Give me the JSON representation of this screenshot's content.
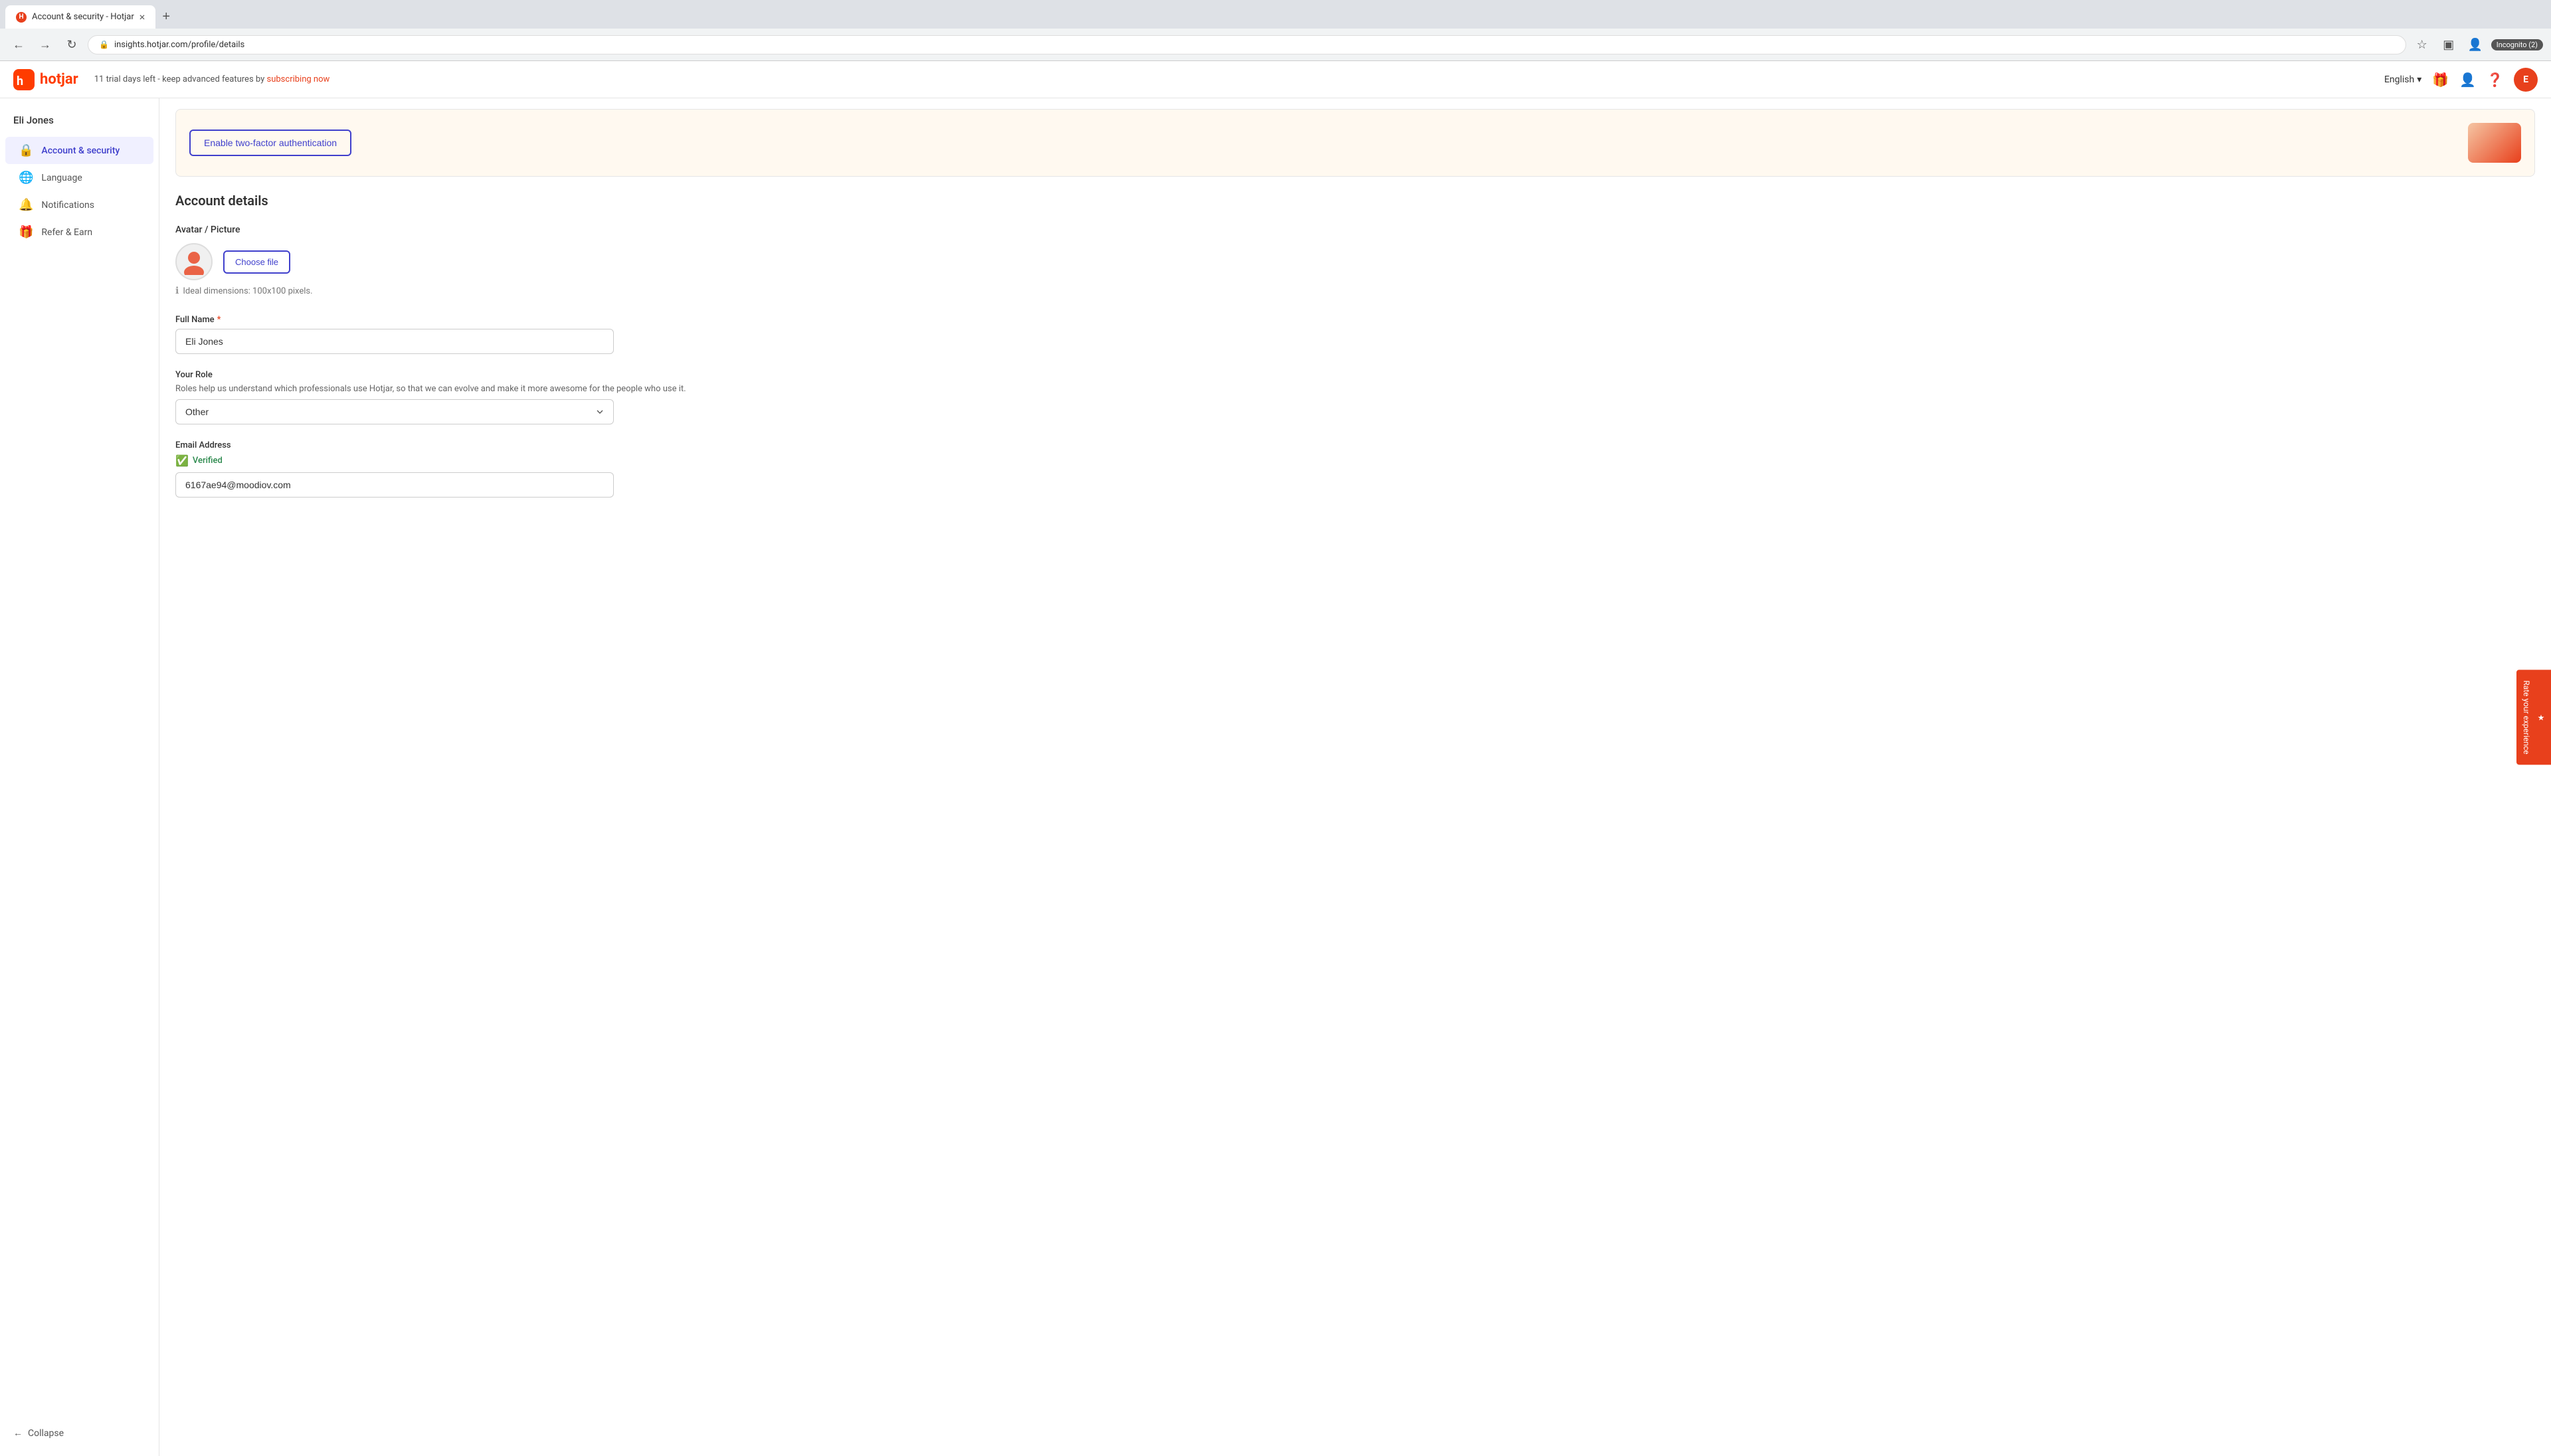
{
  "browser": {
    "tab_title": "Account & security - Hotjar",
    "tab_close": "×",
    "tab_new": "+",
    "address": "insights.hotjar.com/profile/details",
    "back_btn": "←",
    "forward_btn": "→",
    "refresh_btn": "↻",
    "star_btn": "★",
    "incognito_label": "Incognito (2)"
  },
  "header": {
    "logo_text": "hotjar",
    "trial_text": "11 trial days left - keep advanced features by",
    "trial_link_text": "subscribing now",
    "lang_label": "English",
    "lang_arrow": "▾"
  },
  "sidebar": {
    "user_name": "Eli Jones",
    "items": [
      {
        "id": "account-security",
        "label": "Account & security",
        "icon": "🔒",
        "active": true
      },
      {
        "id": "language",
        "label": "Language",
        "icon": "🌐",
        "active": false
      },
      {
        "id": "notifications",
        "label": "Notifications",
        "icon": "🔔",
        "active": false
      },
      {
        "id": "refer-earn",
        "label": "Refer & Earn",
        "icon": "🎁",
        "active": false
      }
    ],
    "collapse_label": "Collapse",
    "collapse_icon": "←"
  },
  "top_card": {
    "btn_label": "Enable two-factor authentication"
  },
  "main": {
    "section_title": "Account details",
    "avatar_label": "Avatar / Picture",
    "choose_file_label": "Choose file",
    "avatar_hint": "Ideal dimensions: 100x100 pixels.",
    "full_name_label": "Full Name",
    "full_name_required": "*",
    "full_name_value": "Eli Jones",
    "role_label": "Your Role",
    "role_description": "Roles help us understand which professionals use Hotjar, so that we can evolve and make it more awesome for the people who use it.",
    "role_value": "Other",
    "email_label": "Email Address",
    "verified_label": "Verified",
    "email_value": "6167ae94@moodiov.com"
  },
  "rate_experience": {
    "label": "Rate your experience",
    "icon": "★"
  }
}
